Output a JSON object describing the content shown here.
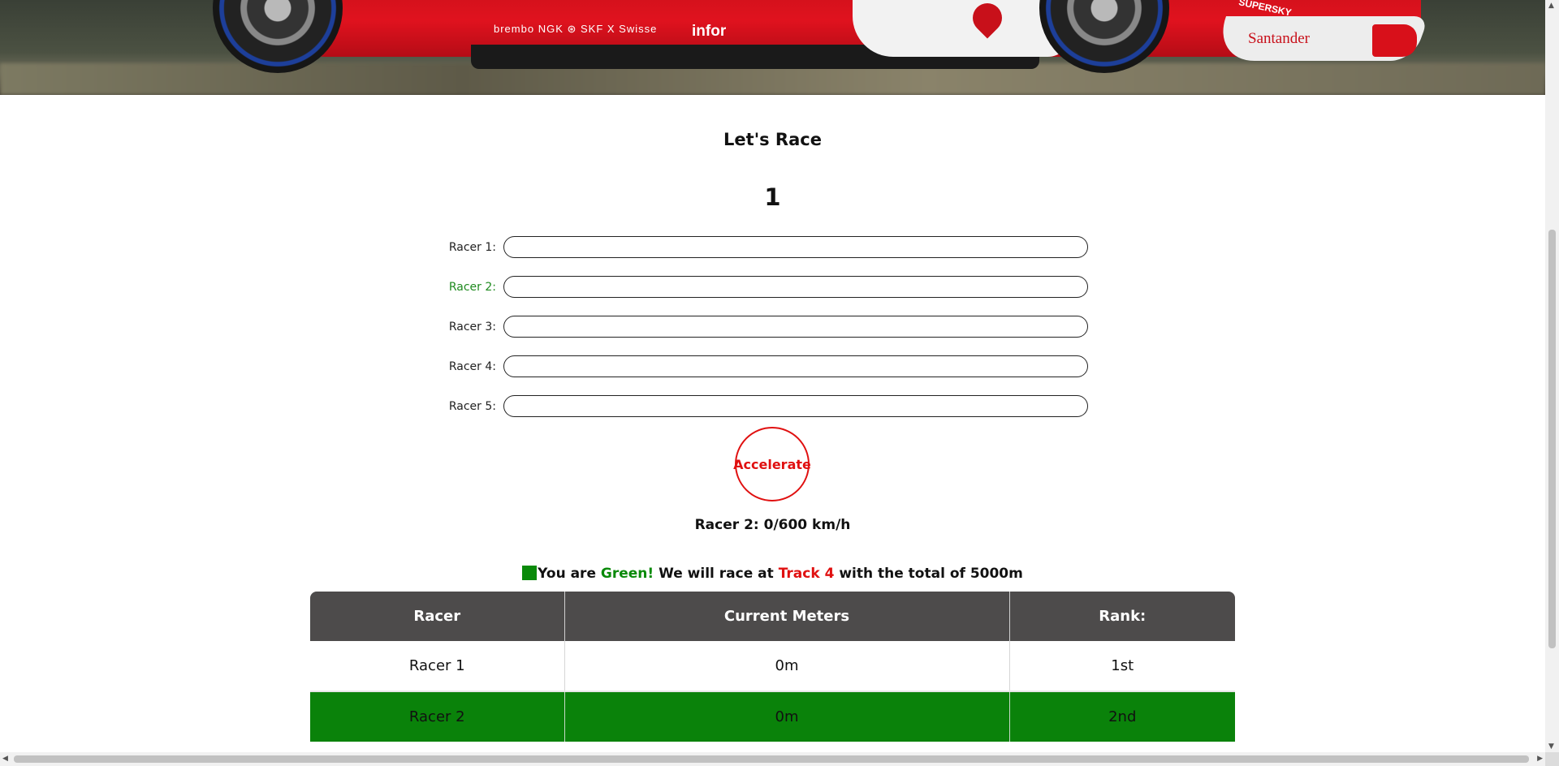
{
  "hero": {
    "sponsors_main": "brembo NGK ⊛ SKF X Swisse",
    "sponsor_big": "infor",
    "sponsor_santander": "Santander",
    "sponsor_top": "SUPERSKY"
  },
  "title": "Let's Race",
  "counter": "1",
  "racers": [
    {
      "label": "Racer 1:",
      "value": "",
      "is_me": false
    },
    {
      "label": "Racer 2:",
      "value": "",
      "is_me": true
    },
    {
      "label": "Racer 3:",
      "value": "",
      "is_me": false
    },
    {
      "label": "Racer 4:",
      "value": "",
      "is_me": false
    },
    {
      "label": "Racer 5:",
      "value": "",
      "is_me": false
    }
  ],
  "accelerate_label": "Accelerate",
  "speed_text": "Racer 2: 0/600 km/h",
  "info": {
    "prefix": "You are ",
    "color_name": "Green!",
    "middle": " We will race at ",
    "track": "Track 4",
    "suffix": " with the total of 5000m",
    "swatch_color": "#0a8a0a",
    "track_color": "#e01010"
  },
  "table": {
    "headers": [
      "Racer",
      "Current Meters",
      "Rank:"
    ],
    "rows": [
      {
        "racer": "Racer 1",
        "meters": "0m",
        "rank": "1st",
        "highlight": false
      },
      {
        "racer": "Racer 2",
        "meters": "0m",
        "rank": "2nd",
        "highlight": true
      }
    ],
    "highlight_color": "#0a820a"
  },
  "colors": {
    "accent_red": "#e01010",
    "accent_green": "#0a8a0a",
    "header_bg": "#4d4b4b"
  }
}
